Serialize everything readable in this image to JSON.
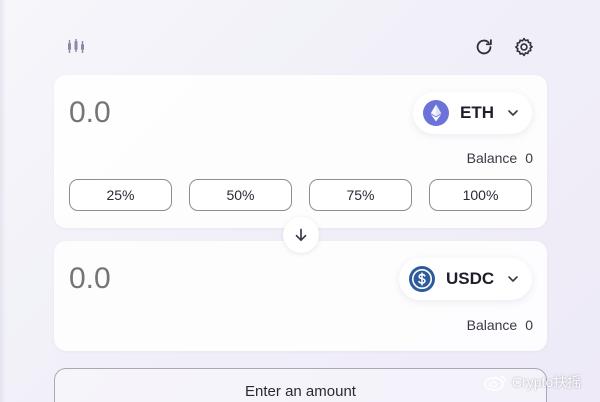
{
  "top_bar": {
    "chart_icon": "candlestick-chart-icon",
    "refresh_icon": "refresh-icon",
    "settings_icon": "gear-icon"
  },
  "from": {
    "amount_placeholder": "0.0",
    "token": "ETH",
    "token_icon": "ethereum-icon",
    "token_color": "#6b73d8",
    "balance_label": "Balance",
    "balance_value": "0",
    "percent_buttons": [
      "25%",
      "50%",
      "75%",
      "100%"
    ]
  },
  "swap_direction_icon": "arrow-down-icon",
  "to": {
    "amount_placeholder": "0.0",
    "token": "USDC",
    "token_icon": "usdc-icon",
    "token_color": "#2d5b9b",
    "balance_label": "Balance",
    "balance_value": "0"
  },
  "action_button": "Enter an amount",
  "watermark": "Crypto扶摇",
  "colors": {
    "background": "#f2f1f8",
    "card": "#ffffff",
    "placeholder": "#c3c3cc",
    "button_border": "#8c8c96"
  }
}
